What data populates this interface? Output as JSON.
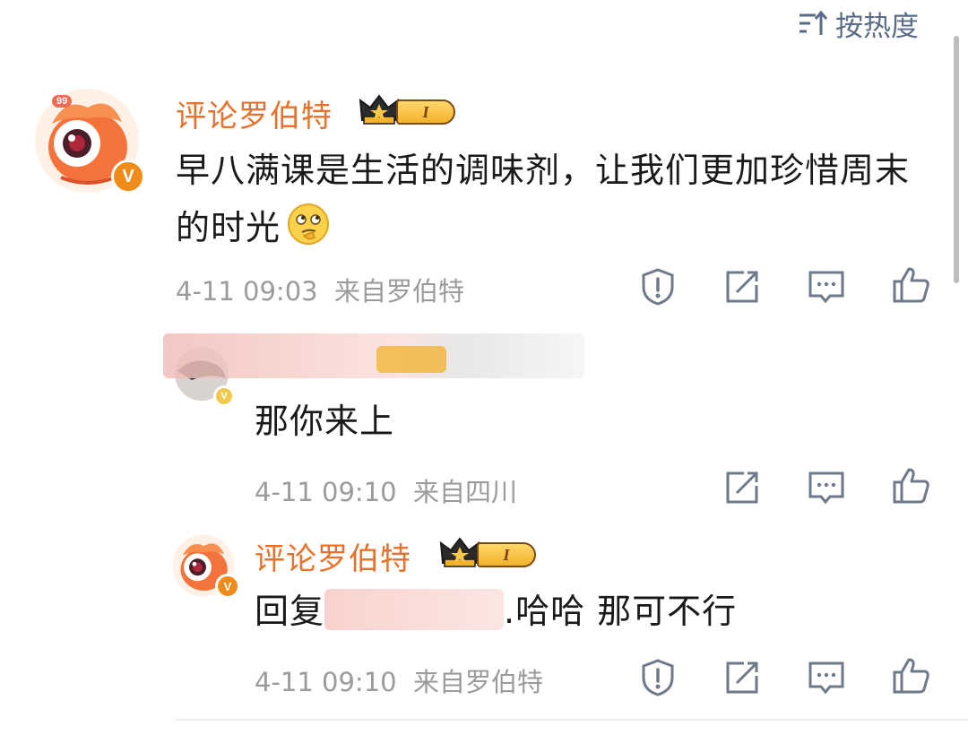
{
  "sort": {
    "icon": "sort-desc-icon",
    "label": "按热度"
  },
  "comments": [
    {
      "user": "评论罗伯特",
      "level": "I",
      "text": "早八满课是生活的调味剂，让我们更加珍惜周末的时光",
      "emoji": "thinking-face",
      "badge_count": "99",
      "verified": "V",
      "time": "4-11 09:03",
      "source": "来自罗伯特",
      "actions": [
        "report-icon",
        "forward-icon",
        "comment-icon",
        "like-icon"
      ]
    },
    {
      "user": "",
      "text": "那你来上",
      "time": "4-11 09:10",
      "source": "来自四川",
      "actions": [
        "forward-icon",
        "comment-icon",
        "like-icon"
      ]
    },
    {
      "user": "评论罗伯特",
      "level": "I",
      "text_prefix": "回复",
      "text_suffix": ".哈哈 那可不行",
      "verified": "V",
      "time": "4-11 09:10",
      "source": "来自罗伯特",
      "actions": [
        "report-icon",
        "forward-icon",
        "comment-icon",
        "like-icon"
      ]
    }
  ],
  "colors": {
    "username": "#e8712b",
    "meta": "#9b9b9b",
    "icons": "#6e7a8a",
    "sort": "#5a6b85"
  }
}
